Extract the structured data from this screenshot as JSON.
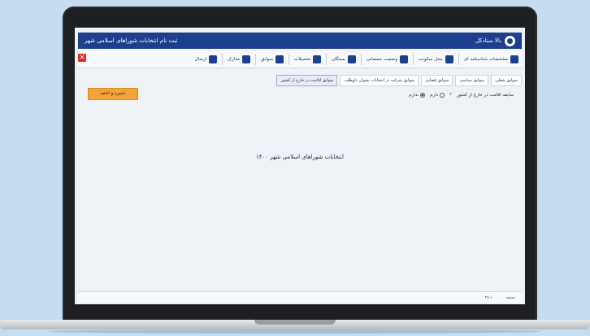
{
  "window": {
    "title": "ثبت نام انتخابات شوراهای اسلامی شهر",
    "brand": "بالا ستادکل"
  },
  "toolbar": {
    "items": [
      {
        "label": "مشخصات شناسنامه ای",
        "icon": "id-card-icon"
      },
      {
        "label": "محل سکونت",
        "icon": "location-pin-icon"
      },
      {
        "label": "وضعیت جسمانی",
        "icon": "person-icon"
      },
      {
        "label": "بستگان",
        "icon": "family-icon"
      },
      {
        "label": "تحصیلات",
        "icon": "graduation-cap-icon"
      },
      {
        "label": "سوابق",
        "icon": "document-icon"
      },
      {
        "label": "مدارک",
        "icon": "files-icon"
      },
      {
        "label": "ارسال",
        "icon": "send-icon"
      }
    ]
  },
  "tabs": [
    {
      "label": "سوابق شغلی",
      "active": false
    },
    {
      "label": "سوابق سیاسی",
      "active": false
    },
    {
      "label": "سوابق قضایی",
      "active": false
    },
    {
      "label": "سوابق شرکت در انتخابات بعنوان داوطلب",
      "active": false
    },
    {
      "label": "سوابق اقامت در خارج از کشور",
      "active": true
    }
  ],
  "question": {
    "label": "سابقه اقامت در خارج از کشور",
    "required_mark": "*",
    "options": [
      {
        "label": "دارم",
        "checked": false
      },
      {
        "label": "ندارم",
        "checked": true
      }
    ]
  },
  "save_button": "ذخیره و ادامه",
  "main": {
    "center_text": "انتخابات شوراهای اسلامی شهر ۱۴۰۰"
  },
  "statusbar": {
    "left": "نسخه",
    "right": "۲۸.۱"
  },
  "colors": {
    "titlebar": "#1c3f8f",
    "save_button": "#f2a23a",
    "close_button": "#d9332a"
  }
}
